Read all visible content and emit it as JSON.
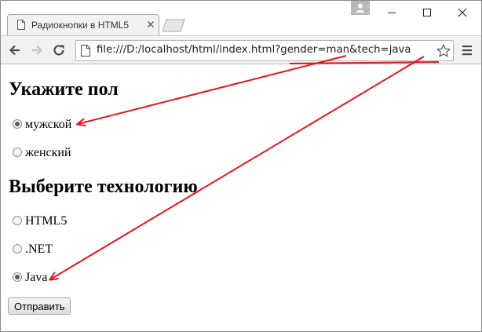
{
  "browser": {
    "tab_title": "Радиокнопки в HTML5",
    "address": "file:///D:/localhost/html/index.html?gender=man&tech=java"
  },
  "form": {
    "gender_heading": "Укажите пол",
    "gender_options": [
      {
        "label": "мужской",
        "checked": true
      },
      {
        "label": "женский",
        "checked": false
      }
    ],
    "tech_heading": "Выберите технологию",
    "tech_options": [
      {
        "label": "HTML5",
        "checked": false
      },
      {
        "label": ".NET",
        "checked": false
      },
      {
        "label": "Java",
        "checked": true
      }
    ],
    "submit_label": "Отправить"
  },
  "annotation": {
    "arrow_color": "#e8141b"
  }
}
